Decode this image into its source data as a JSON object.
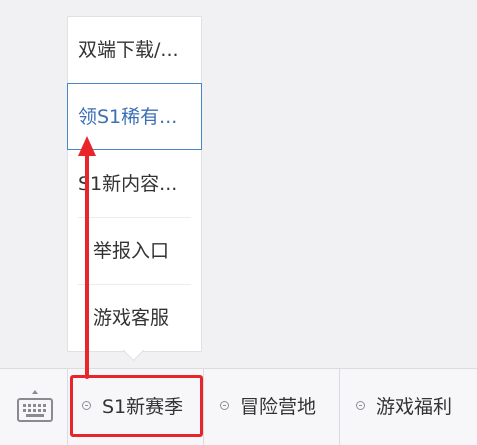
{
  "submenu": {
    "items": [
      {
        "label": "双端下载/..."
      },
      {
        "label": "领S1稀有...",
        "active": true
      },
      {
        "label": "S1新内容..."
      },
      {
        "label": "举报入口"
      },
      {
        "label": "游戏客服"
      }
    ]
  },
  "menubar": {
    "keyboard_icon": "keyboard-icon",
    "tabs": [
      {
        "label": "S1新赛季"
      },
      {
        "label": "冒险营地"
      },
      {
        "label": "游戏福利"
      }
    ]
  },
  "colors": {
    "active_text": "#3d6fb5",
    "active_border": "#4b86c8",
    "annotation_red": "#e8252b",
    "background": "#f1f1f3"
  }
}
